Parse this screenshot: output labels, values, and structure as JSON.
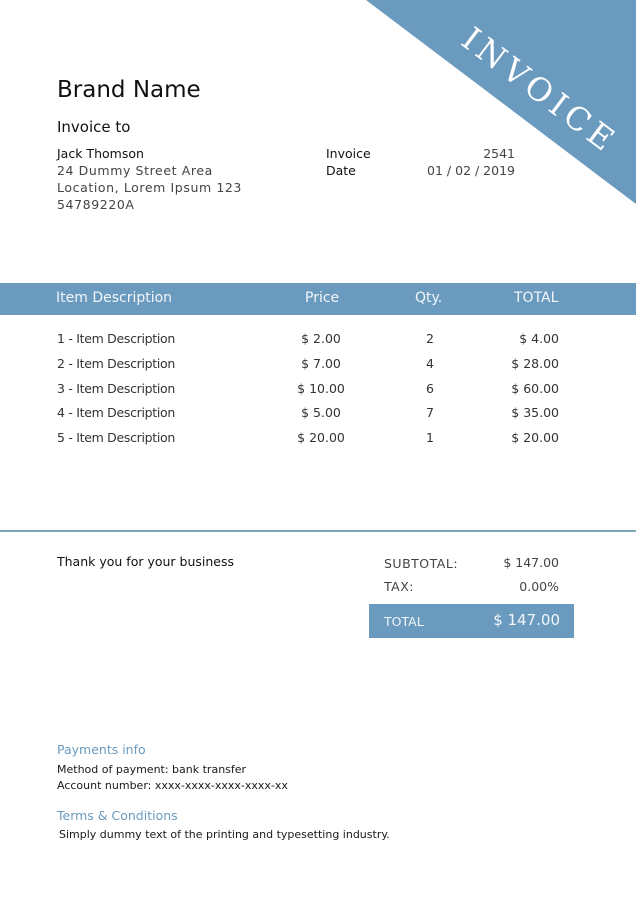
{
  "colors": {
    "accent": "#6a9bbf",
    "divider": "#7aa6b4"
  },
  "corner_label": "INVOICE",
  "brand_name": "Brand Name",
  "invoice_to_label": "Invoice to",
  "client": {
    "name": "Jack Thomson",
    "address_line1": "24 Dummy Street Area",
    "address_line2": "Location, Lorem Ipsum 123",
    "id": "54789220A"
  },
  "meta": {
    "invoice_label": "Invoice",
    "invoice_number": "2541",
    "date_label": "Date",
    "date_value": "01 / 02 / 2019"
  },
  "table": {
    "headers": {
      "description": "Item Description",
      "price": "Price",
      "qty": "Qty.",
      "total": "TOTAL"
    },
    "rows": [
      {
        "description": "1 - Item Description",
        "price": "$ 2.00",
        "qty": "2",
        "total": "$ 4.00"
      },
      {
        "description": "2 - Item Description",
        "price": "$ 7.00",
        "qty": "4",
        "total": "$ 28.00"
      },
      {
        "description": "3 - Item Description",
        "price": "$ 10.00",
        "qty": "6",
        "total": "$ 60.00"
      },
      {
        "description": "4 - Item Description",
        "price": "$ 5.00",
        "qty": "7",
        "total": "$ 35.00"
      },
      {
        "description": "5 - Item Description",
        "price": "$ 20.00",
        "qty": "1",
        "total": "$ 20.00"
      }
    ]
  },
  "thanks": "Thank you for your business",
  "summary": {
    "subtotal_label": "SUBTOTAL:",
    "subtotal_value": "$ 147.00",
    "tax_label": "TAX:",
    "tax_value": "0.00%",
    "total_label": "TOTAL",
    "total_value": "$ 147.00"
  },
  "payments": {
    "title": "Payments info",
    "method": "Method of payment: bank transfer",
    "account": "Account number: xxxx-xxxx-xxxx-xxxx-xx"
  },
  "terms": {
    "title": "Terms & Conditions",
    "text": "Simply dummy text of the printing and typesetting industry."
  }
}
